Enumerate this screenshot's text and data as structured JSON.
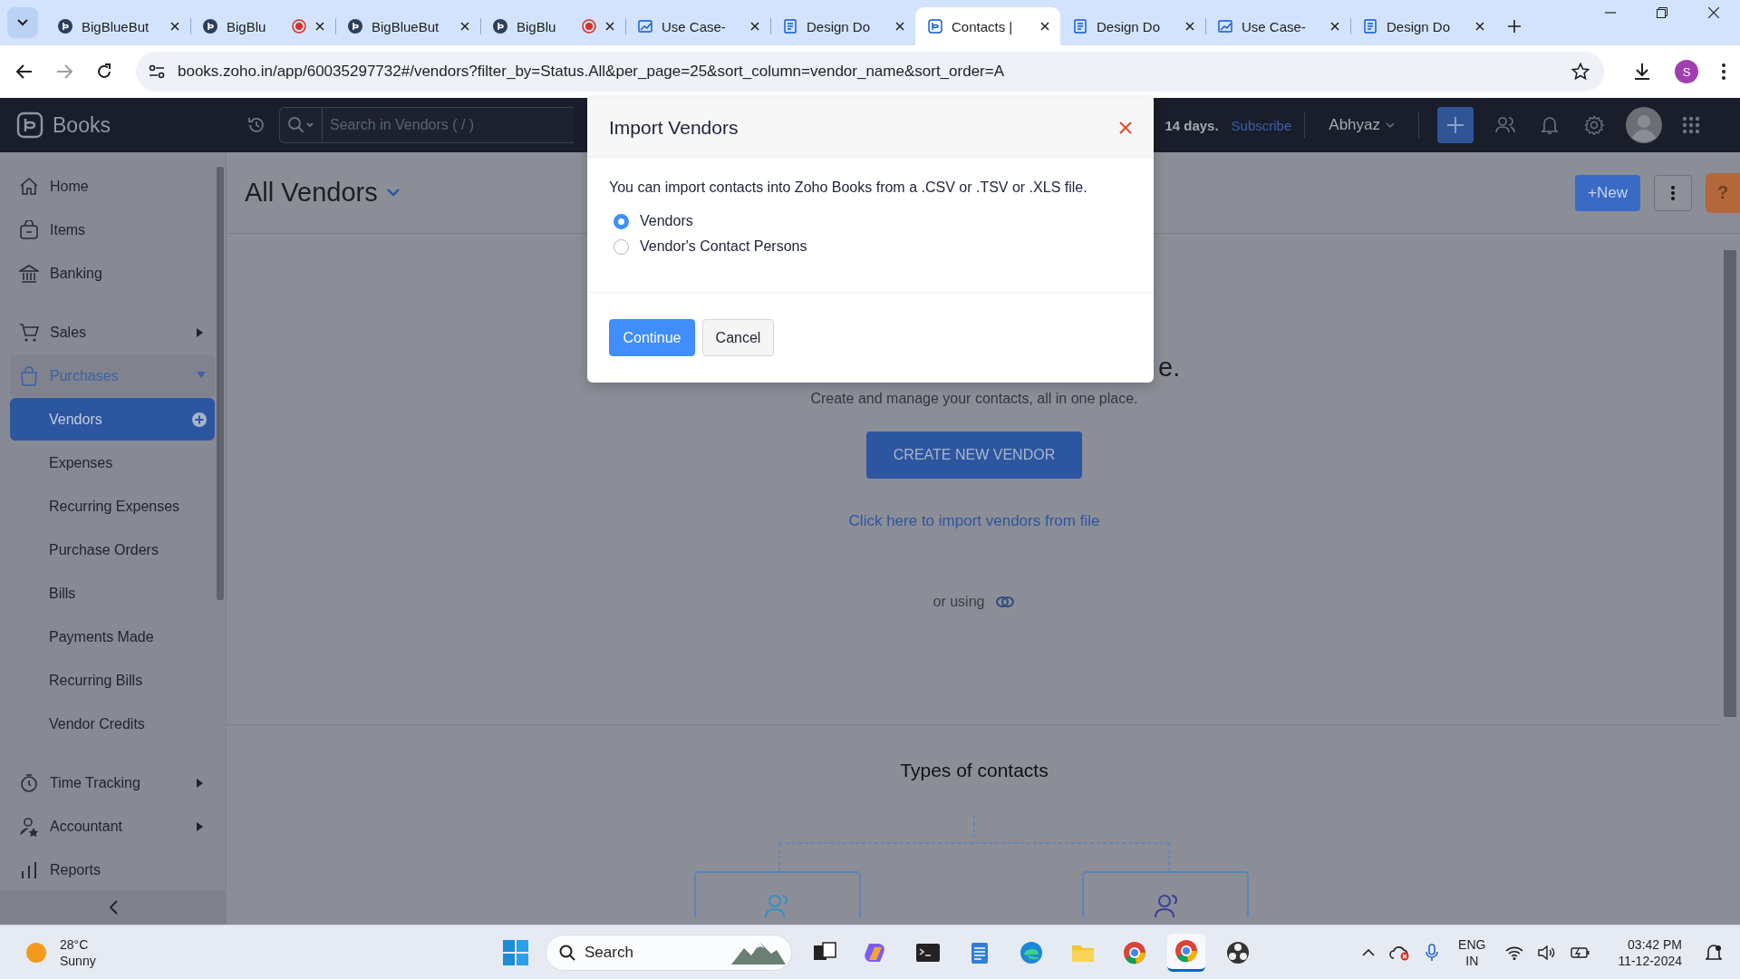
{
  "browser": {
    "tabs": [
      {
        "title": "BigBlueBut",
        "kind": "bigbluebutton",
        "recording": false,
        "selected": false
      },
      {
        "title": "BigBlu",
        "kind": "bigbluebutton",
        "recording": true,
        "selected": false
      },
      {
        "title": "BigBlueBut",
        "kind": "bigbluebutton",
        "recording": false,
        "selected": false
      },
      {
        "title": "BigBlu",
        "kind": "bigbluebutton",
        "recording": true,
        "selected": false
      },
      {
        "title": "Use Case-",
        "kind": "chart",
        "recording": false,
        "selected": false
      },
      {
        "title": "Design Do",
        "kind": "doc",
        "recording": false,
        "selected": false
      },
      {
        "title": "Contacts |",
        "kind": "books",
        "recording": false,
        "selected": true
      },
      {
        "title": "Design Do",
        "kind": "doc",
        "recording": false,
        "selected": false
      },
      {
        "title": "Use Case-",
        "kind": "chart",
        "recording": false,
        "selected": false
      },
      {
        "title": "Design Do",
        "kind": "doc",
        "recording": false,
        "selected": false
      }
    ],
    "address": "books.zoho.in/app/60035297732#/vendors?filter_by=Status.All&per_page=25&sort_column=vendor_name&sort_order=A",
    "profile": "S"
  },
  "header": {
    "brand": "Books",
    "search": {
      "placeholder": "Search in Vendors ( / )"
    },
    "trial": "14 days.",
    "subscribe": "Subscribe",
    "org": "Abhyaz"
  },
  "sidebar": {
    "sections": [
      {
        "items": [
          {
            "label": "Home"
          },
          {
            "label": "Items"
          },
          {
            "label": "Banking"
          }
        ]
      },
      {
        "items": [
          {
            "label": "Sales",
            "expanded": false
          },
          {
            "label": "Purchases",
            "expanded": true,
            "children": [
              {
                "label": "Vendors",
                "selected": true
              },
              {
                "label": "Expenses",
                "selected": false
              },
              {
                "label": "Recurring Expenses",
                "selected": false
              },
              {
                "label": "Purchase Orders",
                "selected": false
              },
              {
                "label": "Bills",
                "selected": false
              },
              {
                "label": "Payments Made",
                "selected": false
              },
              {
                "label": "Recurring Bills",
                "selected": false
              },
              {
                "label": "Vendor Credits",
                "selected": false
              }
            ]
          }
        ]
      },
      {
        "items": [
          {
            "label": "Time Tracking",
            "expanded": false
          },
          {
            "label": "Accountant",
            "expanded": false
          },
          {
            "label": "Reports"
          }
        ]
      }
    ]
  },
  "content": {
    "title": "All Vendors",
    "new_button": "+New",
    "help": "?",
    "heading": "e.",
    "subtitle": "Create and manage your contacts, all in one place.",
    "create_button": "CREATE NEW VENDOR",
    "import_link": "Click here to import vendors from file",
    "or_using": "or using",
    "types_heading": "Types of contacts"
  },
  "modal": {
    "title": "Import Vendors",
    "message": "You can import contacts into Zoho Books from a .CSV or .TSV or .XLS file.",
    "options": [
      {
        "label": "Vendors",
        "selected": true
      },
      {
        "label": "Vendor's Contact Persons",
        "selected": false
      }
    ],
    "buttons": [
      {
        "label": "Continue",
        "kind": "primary"
      },
      {
        "label": "Cancel",
        "kind": "secondary"
      }
    ]
  },
  "taskbar": {
    "weather": {
      "temperature": "28°C",
      "condition": "Sunny"
    },
    "search": {
      "placeholder": "Search"
    },
    "apps": [
      {
        "selected": false
      },
      {
        "selected": false
      },
      {
        "selected": false
      },
      {
        "selected": false
      },
      {
        "selected": false
      },
      {
        "selected": false
      },
      {
        "selected": false
      },
      {
        "selected": true
      },
      {
        "selected": false
      }
    ],
    "language": {
      "top": "ENG",
      "bottom": "IN"
    },
    "time": "03:42 PM",
    "date": "11-12-2024"
  }
}
